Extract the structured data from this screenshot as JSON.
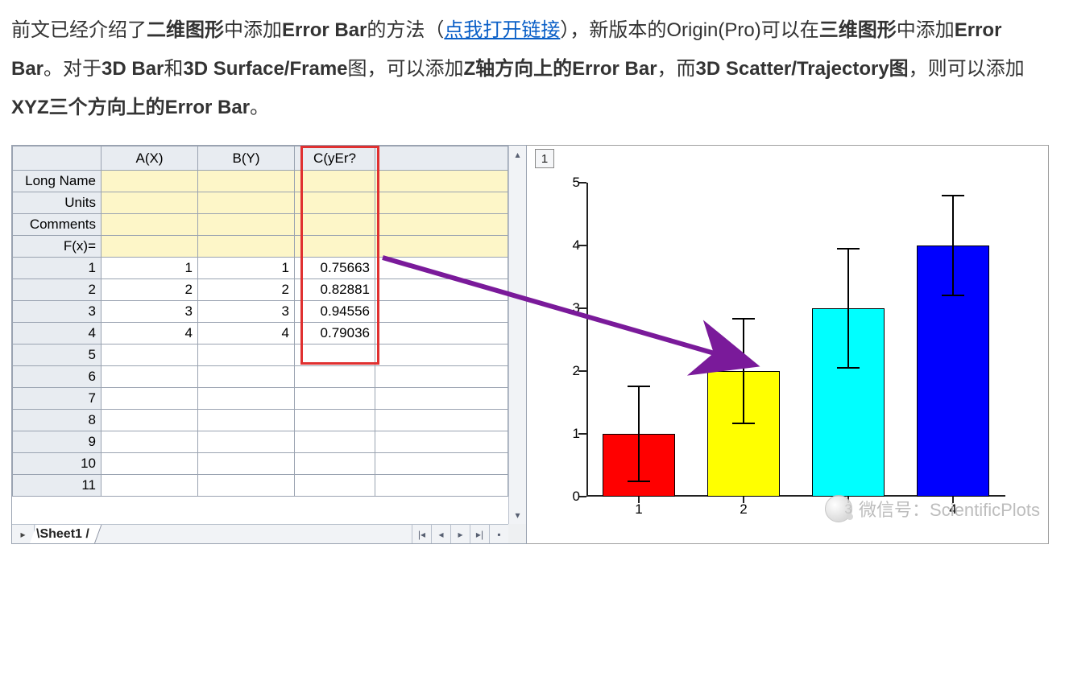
{
  "paragraph": {
    "t1": "前文已经介绍了",
    "b1": "二维图形",
    "t2": "中添加",
    "b2": "Error Bar",
    "t3": "的方法（",
    "link": "点我打开链接",
    "t4": "），新版本的Origin(Pro)可以在",
    "b3": "三维图形",
    "t5": "中添加",
    "b4": "Error Bar",
    "t6": "。对于",
    "b5": "3D Bar",
    "t7": "和",
    "b6": "3D Surface/Frame",
    "t8": "图，可以添加",
    "b7": "Z轴方向上的Error Bar",
    "t9": "，而",
    "b8": "3D Scatter/Trajectory图",
    "t10": "，则可以添加",
    "b9": "XYZ三个方向上的Error Bar",
    "t11": "。"
  },
  "table": {
    "headers": {
      "row": "",
      "A": "A(X)",
      "B": "B(Y)",
      "C": "C(yEr?"
    },
    "meta_rows": [
      "Long Name",
      "Units",
      "Comments",
      "F(x)="
    ],
    "data": [
      {
        "n": "1",
        "A": "1",
        "B": "1",
        "C": "0.75663"
      },
      {
        "n": "2",
        "A": "2",
        "B": "2",
        "C": "0.82881"
      },
      {
        "n": "3",
        "A": "3",
        "B": "3",
        "C": "0.94556"
      },
      {
        "n": "4",
        "A": "4",
        "B": "4",
        "C": "0.79036"
      },
      {
        "n": "5",
        "A": "",
        "B": "",
        "C": ""
      },
      {
        "n": "6",
        "A": "",
        "B": "",
        "C": ""
      },
      {
        "n": "7",
        "A": "",
        "B": "",
        "C": ""
      },
      {
        "n": "8",
        "A": "",
        "B": "",
        "C": ""
      },
      {
        "n": "9",
        "A": "",
        "B": "",
        "C": ""
      },
      {
        "n": "10",
        "A": "",
        "B": "",
        "C": ""
      },
      {
        "n": "11",
        "A": "",
        "B": "",
        "C": ""
      }
    ],
    "tab": "Sheet1"
  },
  "chart_layer": "1",
  "watermark": "微信号：ScientificPlots",
  "chart_data": {
    "type": "bar",
    "categories": [
      "1",
      "2",
      "3",
      "4"
    ],
    "values": [
      1,
      2,
      3,
      4
    ],
    "errors": [
      0.75663,
      0.82881,
      0.94556,
      0.79036
    ],
    "colors": [
      "#ff0000",
      "#ffff00",
      "#00ffff",
      "#0000ff"
    ],
    "ylim": [
      0,
      5
    ],
    "yticks": [
      0,
      1,
      2,
      3,
      4,
      5
    ],
    "xlabel": "",
    "ylabel": "",
    "title": ""
  }
}
